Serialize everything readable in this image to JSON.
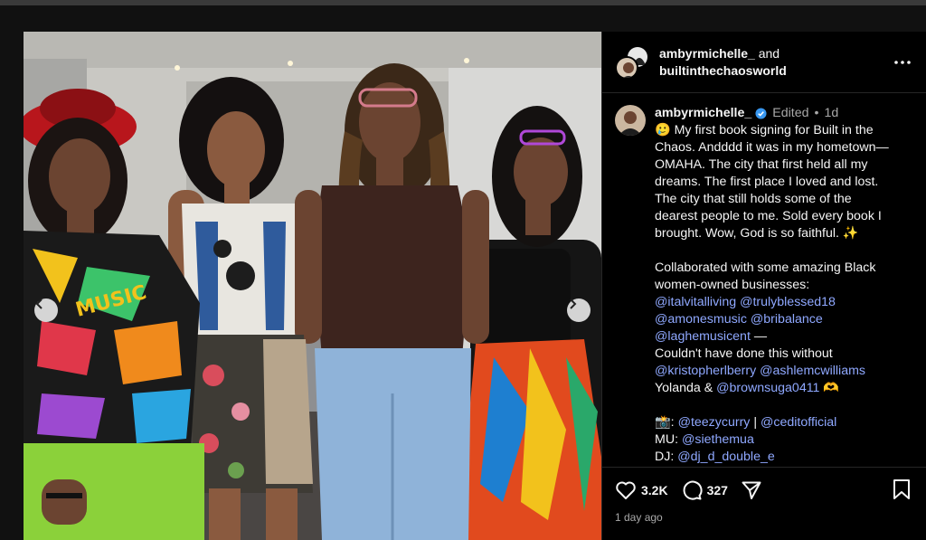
{
  "header": {
    "user1": "ambyrmichelle_",
    "joiner": "and",
    "user2": "builtinthechaosworld"
  },
  "post": {
    "username": "ambyrmichelle_",
    "edited": "Edited",
    "separator": "•",
    "age": "1d",
    "lines": [
      "🥲 My first book signing for Built in the",
      "Chaos. Andddd it was in my hometown—",
      "OMAHA. The city that first held all my",
      "dreams. The first place I loved and lost.",
      "The city that still holds some of the",
      "dearest people to me. Sold every book I",
      "brought. Wow, God is so faithful. ✨"
    ],
    "collab_line1": "Collaborated with some amazing Black",
    "collab_line2": "women-owned businesses:",
    "m1": "@italvitalliving",
    "m2": "@trulyblessed18",
    "m3": "@amonesmusic",
    "m4": "@bribalance",
    "m5": "@laghemusicent",
    "dash": "—",
    "without": "Couldn't have done this without",
    "m6": "@kristopherlberry",
    "m7": "@ashlemcwilliams",
    "yolanda": "Yolanda &",
    "m8": "@brownsuga0411",
    "hands": "🫶",
    "camera": "📸:",
    "m9": "@teezycurry",
    "pipe": "|",
    "m10": "@ceditofficial",
    "mu": "MU:",
    "m11": "@siethemua",
    "dj": "DJ:",
    "m12": "@dj_d_double_e"
  },
  "actions": {
    "likes": "3.2K",
    "comments": "327",
    "time_ago": "1 day ago"
  },
  "icons": {
    "heart": "heart-icon",
    "comment": "comment-icon",
    "share": "share-icon",
    "bookmark": "bookmark-icon",
    "more": "more-icon",
    "prev": "chevron-left-icon",
    "next": "chevron-right-icon",
    "verified": "verified-badge-icon"
  },
  "colors": {
    "mention": "#8fa8ff",
    "background": "#000000",
    "verified": "#3897f0"
  }
}
